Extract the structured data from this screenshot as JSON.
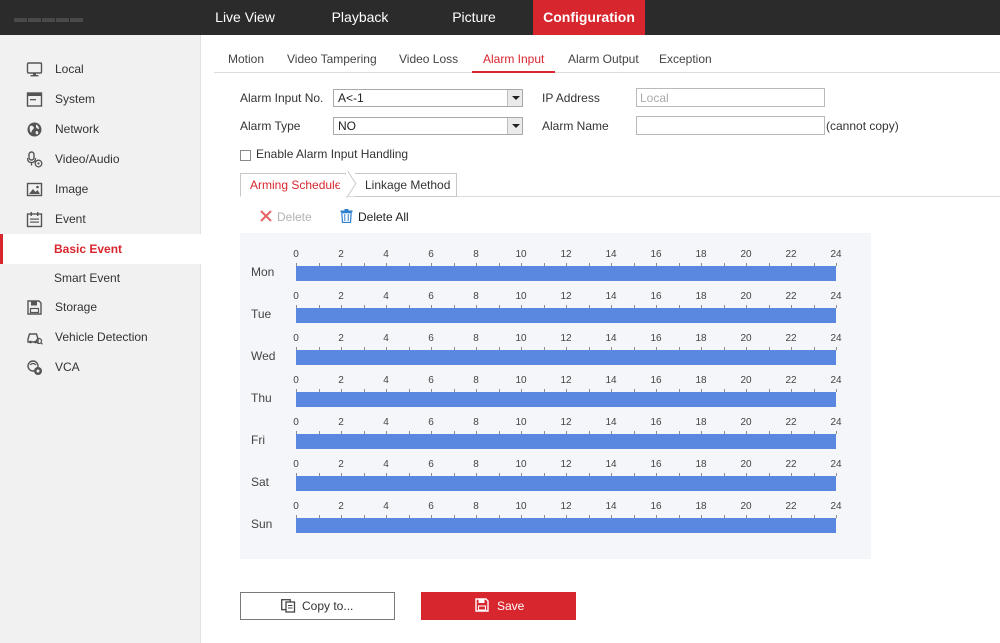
{
  "topnav": {
    "items": [
      {
        "label": "Live View",
        "active": false
      },
      {
        "label": "Playback",
        "active": false
      },
      {
        "label": "Picture",
        "active": false
      },
      {
        "label": "Configuration",
        "active": true
      }
    ],
    "active_color": "#d8262e"
  },
  "sidebar": {
    "items": [
      {
        "label": "Local",
        "icon": "monitor-icon"
      },
      {
        "label": "System",
        "icon": "system-window-icon"
      },
      {
        "label": "Network",
        "icon": "globe-icon"
      },
      {
        "label": "Video/Audio",
        "icon": "microphone-icon"
      },
      {
        "label": "Image",
        "icon": "image-icon"
      },
      {
        "label": "Event",
        "icon": "calendar-icon"
      },
      {
        "label": "Storage",
        "icon": "floppy-disk-icon"
      },
      {
        "label": "Vehicle Detection",
        "icon": "vehicle-icon"
      },
      {
        "label": "VCA",
        "icon": "vca-icon"
      }
    ],
    "sub_items": [
      {
        "label": "Basic Event",
        "active": true
      },
      {
        "label": "Smart Event",
        "active": false
      }
    ]
  },
  "tabs": {
    "items": [
      {
        "label": "Motion",
        "active": false
      },
      {
        "label": "Video Tampering",
        "active": false
      },
      {
        "label": "Video Loss",
        "active": false
      },
      {
        "label": "Alarm Input",
        "active": true
      },
      {
        "label": "Alarm Output",
        "active": false
      },
      {
        "label": "Exception",
        "active": false
      }
    ]
  },
  "form": {
    "alarm_input_no": {
      "label": "Alarm Input No.",
      "value": "A<-1"
    },
    "alarm_type": {
      "label": "Alarm Type",
      "value": "NO"
    },
    "ip_address": {
      "label": "IP Address",
      "placeholder": "Local"
    },
    "alarm_name": {
      "label": "Alarm Name",
      "value": "",
      "note": "(cannot copy)"
    },
    "enable_handling": {
      "label": "Enable Alarm Input Handling",
      "checked": false
    }
  },
  "schedule_tabs": {
    "arming": "Arming Schedule",
    "linkage": "Linkage Method",
    "active": "arming"
  },
  "toolbar": {
    "delete_label": "Delete",
    "delete_all_label": "Delete All"
  },
  "schedule": {
    "days": [
      "Mon",
      "Tue",
      "Wed",
      "Thu",
      "Fri",
      "Sat",
      "Sun"
    ],
    "hour_labels": [
      "0",
      "2",
      "4",
      "6",
      "8",
      "10",
      "12",
      "14",
      "16",
      "18",
      "20",
      "22",
      "24"
    ],
    "bars": [
      {
        "day": "Mon",
        "start": 0,
        "end": 24
      },
      {
        "day": "Tue",
        "start": 0,
        "end": 24
      },
      {
        "day": "Wed",
        "start": 0,
        "end": 24
      },
      {
        "day": "Thu",
        "start": 0,
        "end": 24
      },
      {
        "day": "Fri",
        "start": 0,
        "end": 24
      },
      {
        "day": "Sat",
        "start": 0,
        "end": 24
      },
      {
        "day": "Sun",
        "start": 0,
        "end": 24
      }
    ],
    "bar_color": "#5a87e0"
  },
  "buttons": {
    "copy_label": "Copy to...",
    "save_label": "Save"
  }
}
